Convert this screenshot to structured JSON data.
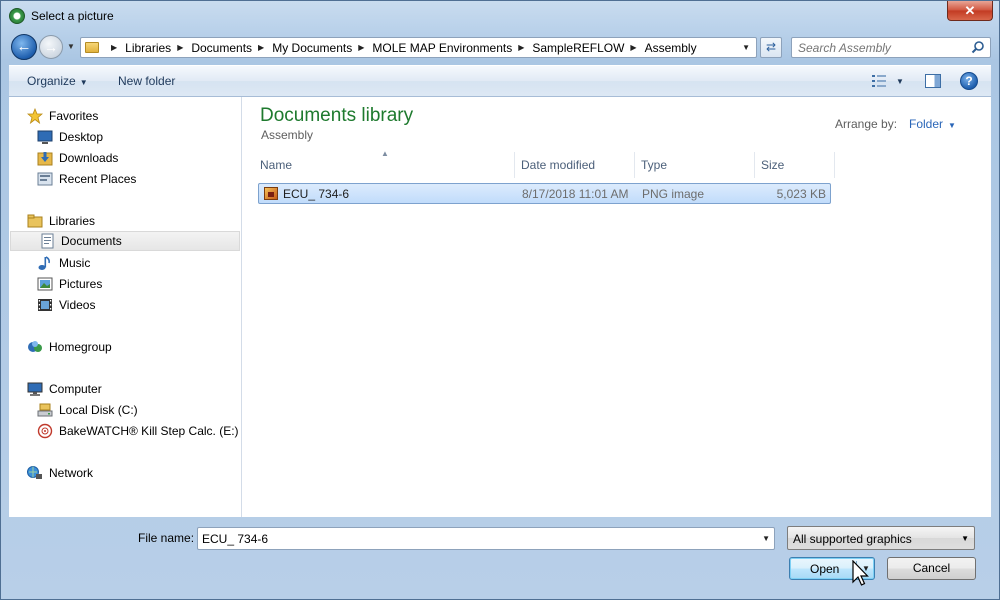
{
  "window": {
    "title": "Select a picture",
    "close_symbol": "✕"
  },
  "address": {
    "breadcrumbs": [
      "Libraries",
      "Documents",
      "My Documents",
      "MOLE MAP Environments",
      "SampleREFLOW",
      "Assembly"
    ],
    "search_placeholder": "Search Assembly"
  },
  "toolbar": {
    "organize_label": "Organize",
    "new_folder_label": "New folder"
  },
  "sidebar": {
    "favorites": {
      "label": "Favorites",
      "items": [
        {
          "label": "Desktop"
        },
        {
          "label": "Downloads"
        },
        {
          "label": "Recent Places"
        }
      ]
    },
    "libraries": {
      "label": "Libraries",
      "items": [
        {
          "label": "Documents",
          "selected": true
        },
        {
          "label": "Music"
        },
        {
          "label": "Pictures"
        },
        {
          "label": "Videos"
        }
      ]
    },
    "homegroup": {
      "label": "Homegroup"
    },
    "computer": {
      "label": "Computer",
      "items": [
        {
          "label": "Local Disk (C:)"
        },
        {
          "label": "BakeWATCH® Kill Step Calc. (E:)"
        }
      ]
    },
    "network": {
      "label": "Network"
    }
  },
  "content": {
    "library_title": "Documents library",
    "library_subtitle": "Assembly",
    "arrange_by_label": "Arrange by:",
    "arrange_by_value": "Folder",
    "columns": [
      "Name",
      "Date modified",
      "Type",
      "Size"
    ],
    "files": [
      {
        "name": "ECU_ 734-6",
        "date_modified": "8/17/2018 11:01 AM",
        "type": "PNG image",
        "size": "5,023 KB",
        "selected": true
      }
    ]
  },
  "footer": {
    "file_name_label": "File name:",
    "file_name_value": "ECU_ 734-6",
    "filter_value": "All supported graphics",
    "open_label": "Open",
    "cancel_label": "Cancel"
  },
  "colors": {
    "library_title": "#1e7a2e",
    "accent_link": "#2a66b8",
    "selection_border": "#7da2ce"
  },
  "icons": [
    "app-icon",
    "close-icon",
    "back-icon",
    "forward-icon",
    "folder-icon",
    "refresh-icon",
    "search-icon",
    "views-icon",
    "preview-pane-icon",
    "help-icon",
    "star-icon",
    "desktop-icon",
    "downloads-icon",
    "recent-places-icon",
    "libraries-icon",
    "documents-icon",
    "music-icon",
    "pictures-icon",
    "videos-icon",
    "homegroup-icon",
    "computer-icon",
    "local-disk-icon",
    "cd-drive-icon",
    "network-icon",
    "png-file-icon",
    "mouse-cursor-icon"
  ]
}
